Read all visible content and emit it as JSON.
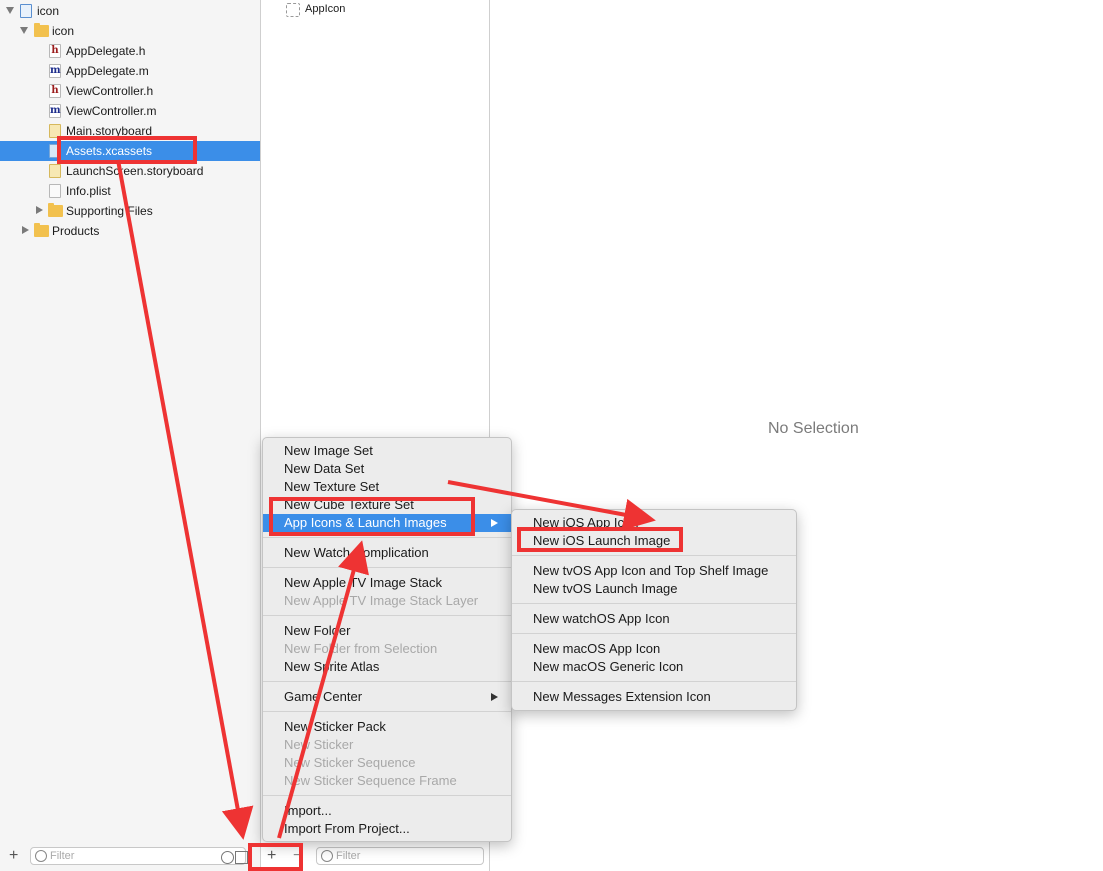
{
  "navigator": {
    "items": [
      {
        "label": "icon",
        "icon": "xcode-project-icon"
      },
      {
        "label": "icon",
        "icon": "folder-icon"
      },
      {
        "label": "AppDelegate.h",
        "icon": "header-file-icon"
      },
      {
        "label": "AppDelegate.m",
        "icon": "objc-source-file-icon"
      },
      {
        "label": "ViewController.h",
        "icon": "header-file-icon"
      },
      {
        "label": "ViewController.m",
        "icon": "objc-source-file-icon"
      },
      {
        "label": "Main.storyboard",
        "icon": "storyboard-file-icon"
      },
      {
        "label": "Assets.xcassets",
        "icon": "asset-catalog-icon"
      },
      {
        "label": "LaunchScreen.storyboard",
        "icon": "storyboard-file-icon"
      },
      {
        "label": "Info.plist",
        "icon": "plist-file-icon"
      },
      {
        "label": "Supporting Files",
        "icon": "folder-icon"
      },
      {
        "label": "Products",
        "icon": "folder-icon"
      }
    ],
    "filter_placeholder": "Filter",
    "add_label": "+"
  },
  "asset_list": {
    "items": [
      {
        "label": "AppIcon"
      }
    ],
    "add_label": "+",
    "remove_label": "−",
    "filter_placeholder": "Filter"
  },
  "editor": {
    "empty_text": "No Selection"
  },
  "context_menu": {
    "items": [
      {
        "label": "New Image Set",
        "enabled": true
      },
      {
        "label": "New Data Set",
        "enabled": true
      },
      {
        "label": "New Texture Set",
        "enabled": true
      },
      {
        "label": "New Cube Texture Set",
        "enabled": true
      },
      {
        "label": "App Icons & Launch Images",
        "enabled": true,
        "submenu": true,
        "highlighted": true
      },
      {
        "label": "New Watch Complication",
        "enabled": true
      },
      {
        "label": "New Apple TV Image Stack",
        "enabled": true
      },
      {
        "label": "New Apple TV Image Stack Layer",
        "enabled": false
      },
      {
        "label": "New Folder",
        "enabled": true
      },
      {
        "label": "New Folder from Selection",
        "enabled": false
      },
      {
        "label": "New Sprite Atlas",
        "enabled": true
      },
      {
        "label": "Game Center",
        "enabled": true,
        "submenu": true
      },
      {
        "label": "New Sticker Pack",
        "enabled": true
      },
      {
        "label": "New Sticker",
        "enabled": false
      },
      {
        "label": "New Sticker Sequence",
        "enabled": false
      },
      {
        "label": "New Sticker Sequence Frame",
        "enabled": false
      },
      {
        "label": "Import...",
        "enabled": true
      },
      {
        "label": "Import From Project...",
        "enabled": true
      }
    ]
  },
  "submenu": {
    "items": [
      {
        "label": "New iOS App Icon"
      },
      {
        "label": "New iOS Launch Image"
      },
      {
        "label": "New tvOS App Icon and Top Shelf Image"
      },
      {
        "label": "New tvOS Launch Image"
      },
      {
        "label": "New watchOS App Icon"
      },
      {
        "label": "New macOS App Icon"
      },
      {
        "label": "New macOS Generic Icon"
      },
      {
        "label": "New Messages Extension Icon"
      }
    ]
  },
  "colors": {
    "annotation": "#ee3333",
    "selection": "#3b8ee8",
    "menu_bg": "#ececec"
  }
}
